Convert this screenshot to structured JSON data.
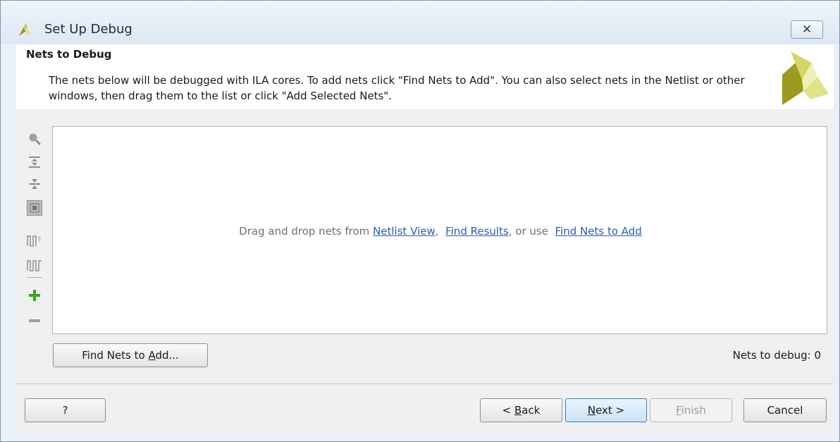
{
  "window": {
    "title": "Set Up Debug",
    "close_glyph": "✕"
  },
  "header": {
    "title": "Nets to Debug",
    "description": "The nets below will be debugged with ILA cores. To add nets click \"Find Nets to Add\". You can also select nets in the Netlist or other windows, then drag them to the list or click \"Add Selected Nets\"."
  },
  "toolbar": {
    "icons": [
      "search-icon",
      "expand-all-icon",
      "collapse-all-icon",
      "select-all-icon",
      "probe-type-icon",
      "waveform-icon",
      "add-icon",
      "remove-icon"
    ]
  },
  "list": {
    "hint_prefix": "Drag and drop nets from ",
    "link_netlist": "Netlist View",
    "sep1": ",  ",
    "link_find_results": "Find Results",
    "sep2": ", or use  ",
    "link_find_nets": "Find Nets to Add"
  },
  "actions": {
    "find_nets_pre": "Find Nets to ",
    "find_nets_mn": "A",
    "find_nets_post": "dd...",
    "count_label": "Nets to debug: 0"
  },
  "footer": {
    "help": "?",
    "back_pre": "< ",
    "back_mn": "B",
    "back_post": "ack",
    "next_mn": "N",
    "next_post": "ext >",
    "finish_mn": "F",
    "finish_post": "inish",
    "cancel": "Cancel"
  },
  "colors": {
    "accent": "#3c7fb1",
    "link": "#2a5db0",
    "add_green": "#3aa21c",
    "logo_olive": "#9b9b1d",
    "logo_light": "#dfe389"
  }
}
